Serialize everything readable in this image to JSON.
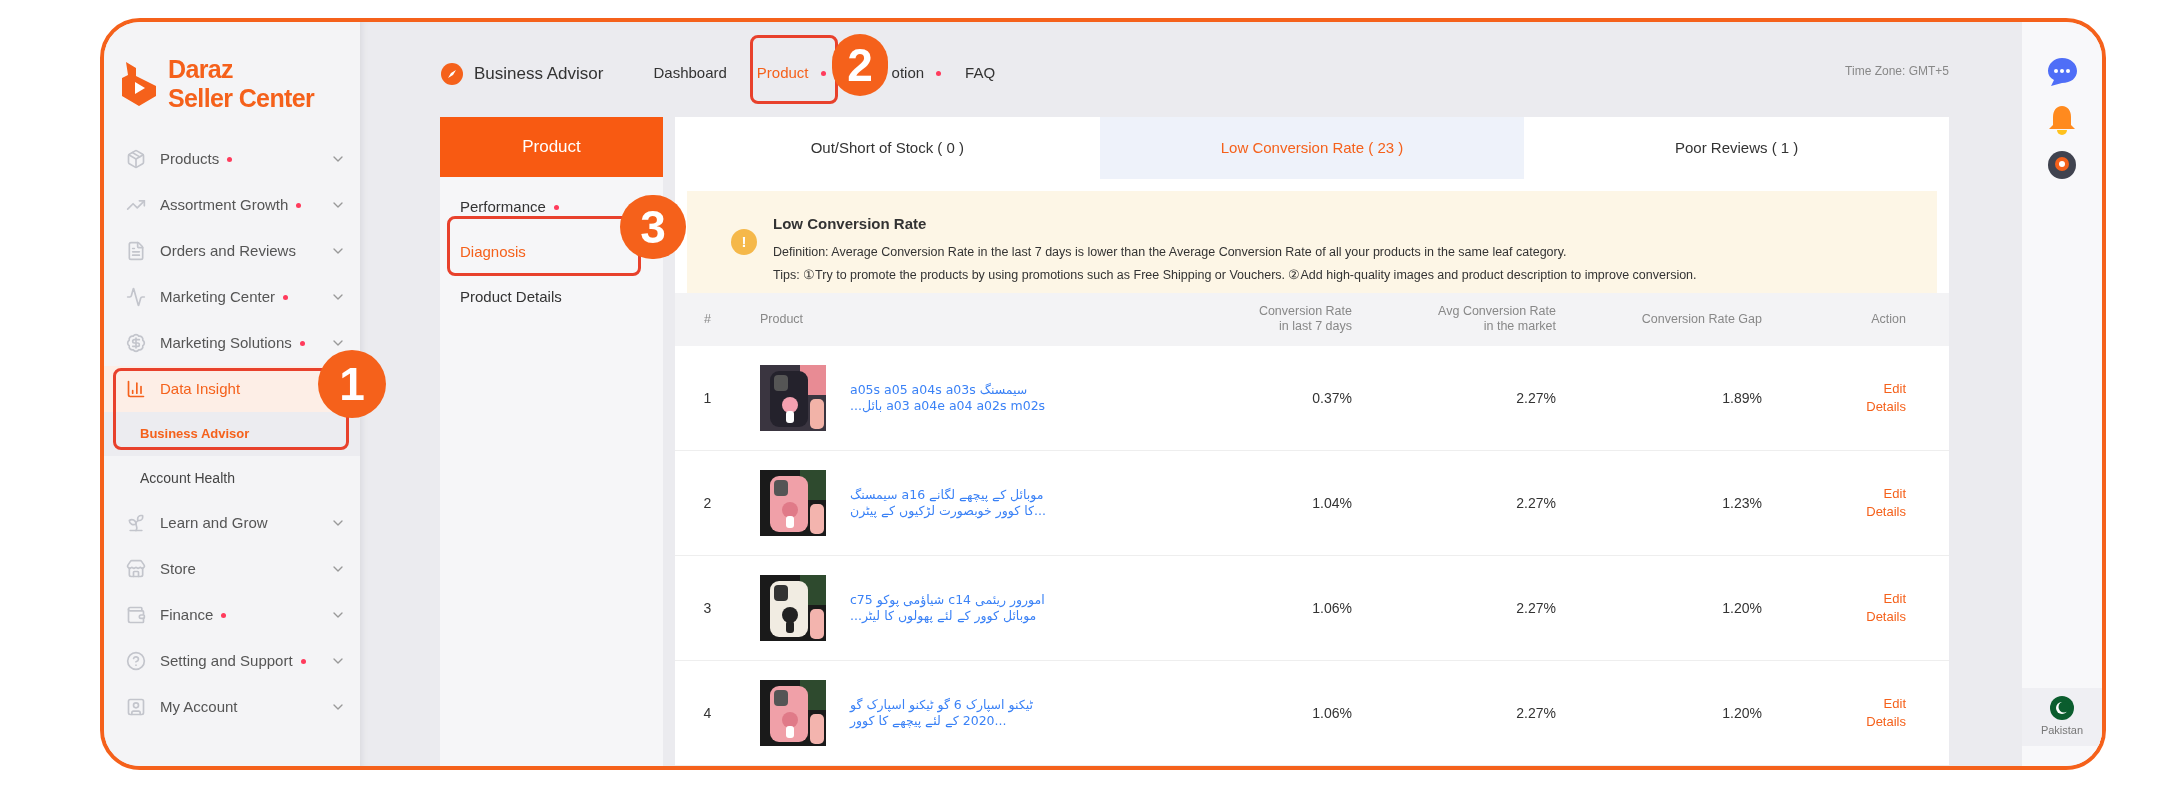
{
  "sidebar": {
    "logo": {
      "line1": "Daraz",
      "line2": "Seller Center"
    },
    "items": [
      {
        "label": "Products",
        "dot": true,
        "expanded": false,
        "selected": false
      },
      {
        "label": "Assortment Growth",
        "dot": true,
        "expanded": false,
        "selected": false
      },
      {
        "label": "Orders and Reviews",
        "dot": false,
        "expanded": false,
        "selected": false
      },
      {
        "label": "Marketing Center",
        "dot": true,
        "expanded": false,
        "selected": false
      },
      {
        "label": "Marketing Solutions",
        "dot": true,
        "expanded": false,
        "selected": false
      },
      {
        "label": "Data Insight",
        "dot": false,
        "expanded": true,
        "selected": true,
        "children": [
          {
            "label": "Business Advisor",
            "selected": true
          },
          {
            "label": "Account Health",
            "selected": false
          }
        ]
      },
      {
        "label": "Learn and Grow",
        "dot": false,
        "expanded": false,
        "selected": false
      },
      {
        "label": "Store",
        "dot": false,
        "expanded": false,
        "selected": false
      },
      {
        "label": "Finance",
        "dot": true,
        "expanded": false,
        "selected": false
      },
      {
        "label": "Setting and Support",
        "dot": true,
        "expanded": false,
        "selected": false
      },
      {
        "label": "My Account",
        "dot": false,
        "expanded": false,
        "selected": false
      }
    ]
  },
  "topnav": {
    "title": "Business Advisor",
    "links": [
      {
        "label": "Dashboard",
        "selected": false,
        "dot": false
      },
      {
        "label": "Product",
        "selected": true,
        "dot": true
      },
      {
        "label": "otion",
        "selected": false,
        "dot": true
      },
      {
        "label": "FAQ",
        "selected": false,
        "dot": false
      }
    ],
    "timezone": "Time Zone: GMT+5"
  },
  "subnav": {
    "header": "Product",
    "items": [
      {
        "label": "Performance",
        "selected": false,
        "dot": true
      },
      {
        "label": "Diagnosis",
        "selected": true,
        "dot": false
      },
      {
        "label": "Product Details",
        "selected": false,
        "dot": false
      }
    ]
  },
  "tabs": [
    {
      "label": "Out/Short of Stock ( 0 )",
      "selected": false
    },
    {
      "label": "Low Conversion Rate ( 23 )",
      "selected": true
    },
    {
      "label": "Poor Reviews ( 1 )",
      "selected": false
    }
  ],
  "notice": {
    "icon_text": "!",
    "title": "Low Conversion Rate",
    "definition": "Definition: Average Conversion Rate in the last 7 days is lower than the Average Conversion Rate of all your products in the same leaf category.",
    "tips": "Tips: ①Try to promote the products by using promotions such as Free Shipping or Vouchers. ②Add high-quality images and product description to improve conversion."
  },
  "table": {
    "columns": [
      "#",
      "Product",
      "Conversion Rate\nin last 7 days",
      "Avg Conversion Rate\nin the market",
      "Conversion Rate Gap",
      "Action"
    ],
    "rows": [
      {
        "index": "1",
        "title": [
          "سیمسنگ a05s a05 a04s a03s",
          "a03 a04e a04 a02s m02s بائل..."
        ],
        "conversion_rate": "0.37%",
        "avg_rate": "2.27%",
        "gap": "1.89%",
        "actions": [
          "Edit",
          "Details"
        ]
      },
      {
        "index": "2",
        "title": [
          "موبائل کے پیچھے لگانے a16 سیمسنگ",
          "...کا کوور خوبصورت لڑکیوں کے پیٹرن"
        ],
        "conversion_rate": "1.04%",
        "avg_rate": "2.27%",
        "gap": "1.23%",
        "actions": [
          "Edit",
          "Details"
        ]
      },
      {
        "index": "3",
        "title": [
          "c75 شیاؤمی پوکو cامورور ریئمی 14",
          "...موبائل کوور کے لئے پھولوں کا لیٹر"
        ],
        "conversion_rate": "1.06%",
        "avg_rate": "2.27%",
        "gap": "1.20%",
        "actions": [
          "Edit",
          "Details"
        ]
      },
      {
        "index": "4",
        "title": [
          "ٹیکنو اسپارک 6 گو ٹیکنو اسپارک گو",
          "...2020 کے لئے پیچھے کا کوور"
        ],
        "conversion_rate": "1.06%",
        "avg_rate": "2.27%",
        "gap": "1.20%",
        "actions": [
          "Edit",
          "Details"
        ]
      }
    ]
  },
  "callouts": [
    {
      "number": "1"
    },
    {
      "number": "2"
    },
    {
      "number": "3"
    }
  ],
  "right_rail": {
    "country": "Pakistan"
  }
}
